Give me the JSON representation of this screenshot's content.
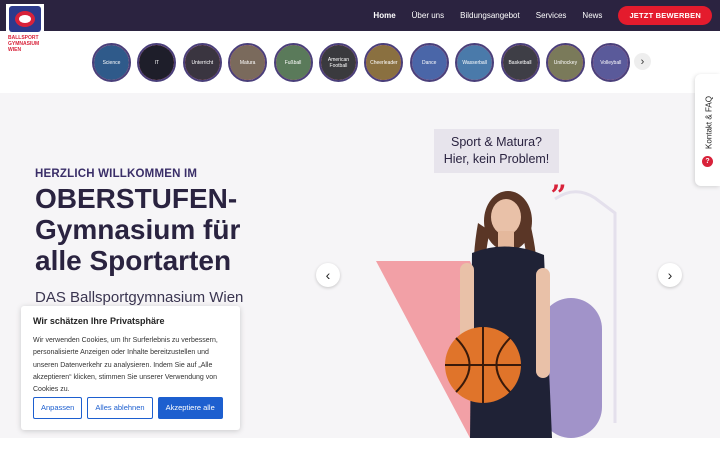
{
  "logo": {
    "text": "BALLSPORT GYMNASIUM WIEN"
  },
  "nav": {
    "items": [
      {
        "label": "Home"
      },
      {
        "label": "Über uns"
      },
      {
        "label": "Bildungsangebot"
      },
      {
        "label": "Services"
      },
      {
        "label": "News"
      }
    ],
    "cta_label": "JETZT BEWERBEN"
  },
  "sports": [
    {
      "label": "Science"
    },
    {
      "label": "IT"
    },
    {
      "label": "Unterricht"
    },
    {
      "label": "Matura"
    },
    {
      "label": "Fußball"
    },
    {
      "label": "American Football"
    },
    {
      "label": "Cheerleader"
    },
    {
      "label": "Dance"
    },
    {
      "label": "Wasserball"
    },
    {
      "label": "Basketball"
    },
    {
      "label": "Unihockey"
    },
    {
      "label": "Volleyball"
    }
  ],
  "hero": {
    "welcome": "HERZLICH WILLKOMMEN IM",
    "headline": "OBERSTUFEN-Gymnasium für alle Sportarten",
    "subline": "DAS Ballsportgymnasium Wien",
    "quote_line1": "Sport & Matura?",
    "quote_line2": "Hier, kein Problem!",
    "quote_mark": "„"
  },
  "sidetab": {
    "label": "Kontakt & FAQ",
    "icon": "?"
  },
  "cookie": {
    "title": "Wir schätzen Ihre Privatsphäre",
    "text": "Wir verwenden Cookies, um Ihr Surferlebnis zu verbessern, personalisierte Anzeigen oder Inhalte bereitzustellen und unseren Datenverkehr zu analysieren. Indem Sie auf „Alle akzeptieren“ klicken, stimmen Sie unserer Verwendung von Cookies zu.",
    "btn_customize": "Anpassen",
    "btn_reject": "Alles ablehnen",
    "btn_accept": "Akzeptiere alle"
  },
  "colors": {
    "nav_bg": "#2b2340",
    "accent_red": "#e41b2d",
    "accent_blue": "#1d5fcf",
    "pink": "#f2a0a6",
    "purple": "#a193c9"
  }
}
